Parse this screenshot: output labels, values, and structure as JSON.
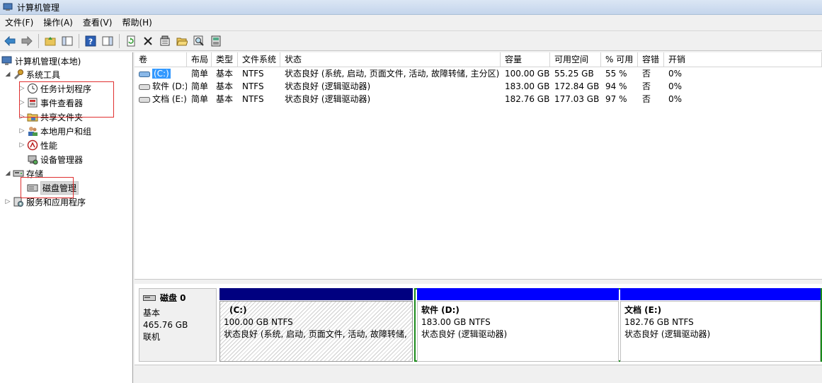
{
  "window": {
    "title": "计算机管理"
  },
  "menu": [
    "文件(F)",
    "操作(A)",
    "查看(V)",
    "帮助(H)"
  ],
  "toolbar": {
    "buttons": [
      "back-icon",
      "forward-icon",
      "up-folder-icon",
      "show-hide-tree-icon",
      "help-icon",
      "show-hide-action-icon",
      "refresh-icon",
      "delete-icon",
      "properties-icon",
      "open-icon",
      "search-icon",
      "more-icon"
    ]
  },
  "tree": {
    "root": "计算机管理(本地)",
    "system_tools": "系统工具",
    "task_scheduler": "任务计划程序",
    "event_viewer": "事件查看器",
    "shared_folders": "共享文件夹",
    "local_users": "本地用户和组",
    "performance": "性能",
    "device_manager": "设备管理器",
    "storage": "存储",
    "disk_management": "磁盘管理",
    "services": "服务和应用程序"
  },
  "volume_table": {
    "headers": [
      "卷",
      "布局",
      "类型",
      "文件系统",
      "状态",
      "容量",
      "可用空间",
      "% 可用",
      "容错",
      "开销"
    ],
    "rows": [
      [
        "(C:)",
        "简单",
        "基本",
        "NTFS",
        "状态良好 (系统, 启动, 页面文件, 活动, 故障转储, 主分区)",
        "100.00 GB",
        "55.25 GB",
        "55 %",
        "否",
        "0%"
      ],
      [
        "软件 (D:)",
        "简单",
        "基本",
        "NTFS",
        "状态良好 (逻辑驱动器)",
        "183.00 GB",
        "172.84 GB",
        "94 %",
        "否",
        "0%"
      ],
      [
        "文档 (E:)",
        "简单",
        "基本",
        "NTFS",
        "状态良好 (逻辑驱动器)",
        "182.76 GB",
        "177.03 GB",
        "97 %",
        "否",
        "0%"
      ]
    ]
  },
  "disk": {
    "name": "磁盘 0",
    "type": "基本",
    "size": "465.76 GB",
    "status": "联机",
    "partitions": [
      {
        "name": "(C:)",
        "size": "100.00 GB NTFS",
        "status": "状态良好 (系统, 启动, 页面文件, 活动, 故障转储,"
      },
      {
        "name": "软件  (D:)",
        "size": "183.00 GB NTFS",
        "status": "状态良好 (逻辑驱动器)"
      },
      {
        "name": "文档  (E:)",
        "size": "182.76 GB NTFS",
        "status": "状态良好 (逻辑驱动器)"
      }
    ]
  },
  "colors": {
    "primary_bar": "#000080",
    "logical_bar": "#0000ff",
    "extended_border": "#1a8a1a",
    "highlight": "#3399ff"
  }
}
